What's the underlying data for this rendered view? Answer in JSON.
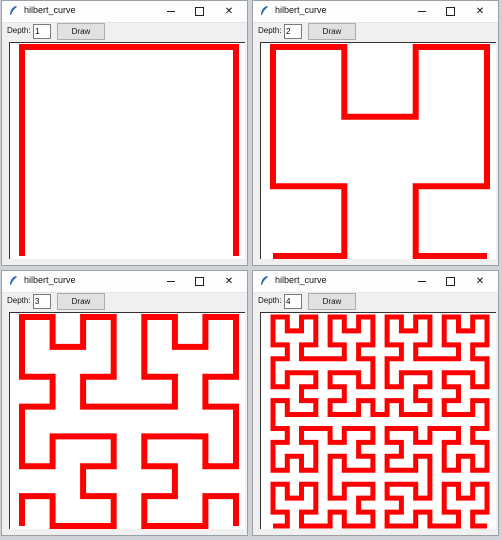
{
  "windows": [
    {
      "title": "hilbert_curve",
      "depth_label": "Depth:",
      "depth_value": "1",
      "button_label": "Draw",
      "curve_depth": 1
    },
    {
      "title": "hilbert_curve",
      "depth_label": "Depth:",
      "depth_value": "2",
      "button_label": "Draw",
      "curve_depth": 2
    },
    {
      "title": "hilbert_curve",
      "depth_label": "Depth:",
      "depth_value": "3",
      "button_label": "Draw",
      "curve_depth": 3
    },
    {
      "title": "hilbert_curve",
      "depth_label": "Depth:",
      "depth_value": "4",
      "button_label": "Draw",
      "curve_depth": 4
    }
  ],
  "window_controls": {
    "minimize": "minimize-icon",
    "maximize": "maximize-icon",
    "close": "close-icon"
  },
  "colors": {
    "curve": "#ff0000",
    "canvas": "#ffffff",
    "window_bg": "#f0f0f0"
  }
}
